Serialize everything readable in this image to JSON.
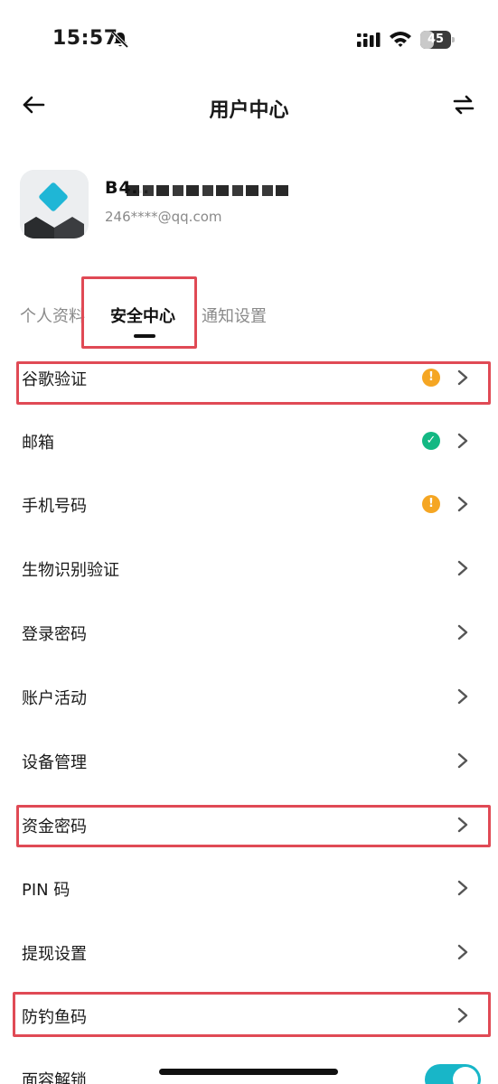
{
  "status_bar": {
    "time": "15:57",
    "battery": "45",
    "battery_level": 0.45
  },
  "header": {
    "title": "用户中心"
  },
  "profile": {
    "username": "B4…",
    "email": "246****@qq.com"
  },
  "tabs": [
    {
      "label": "个人资料",
      "active": false
    },
    {
      "label": "安全中心",
      "active": true
    },
    {
      "label": "通知设置",
      "active": false
    }
  ],
  "security_items": [
    {
      "label": "谷歌验证",
      "status": "warning",
      "status_icon": "warning-icon",
      "highlighted": true
    },
    {
      "label": "邮箱",
      "status": "verified",
      "status_icon": "check-icon",
      "highlighted": false
    },
    {
      "label": "手机号码",
      "status": "warning",
      "status_icon": "warning-icon",
      "highlighted": false
    },
    {
      "label": "生物识别验证",
      "status": "",
      "highlighted": false
    },
    {
      "label": "登录密码",
      "status": "",
      "highlighted": false
    },
    {
      "label": "账户活动",
      "status": "",
      "highlighted": false
    },
    {
      "label": "设备管理",
      "status": "",
      "highlighted": false
    },
    {
      "label": "资金密码",
      "status": "",
      "highlighted": true
    },
    {
      "label": "PIN 码",
      "status": "",
      "highlighted": false
    },
    {
      "label": "提现设置",
      "status": "",
      "highlighted": false
    },
    {
      "label": "防钓鱼码",
      "status": "",
      "highlighted": true
    },
    {
      "label": "面容解锁",
      "status": "toggle-on",
      "highlighted": false
    }
  ],
  "colors": {
    "warning": "#f5a623",
    "verified": "#13b883",
    "toggle_on": "#18b6c8",
    "annotation": "#e04a55",
    "avatar_diamond": "#1fb6d6"
  }
}
